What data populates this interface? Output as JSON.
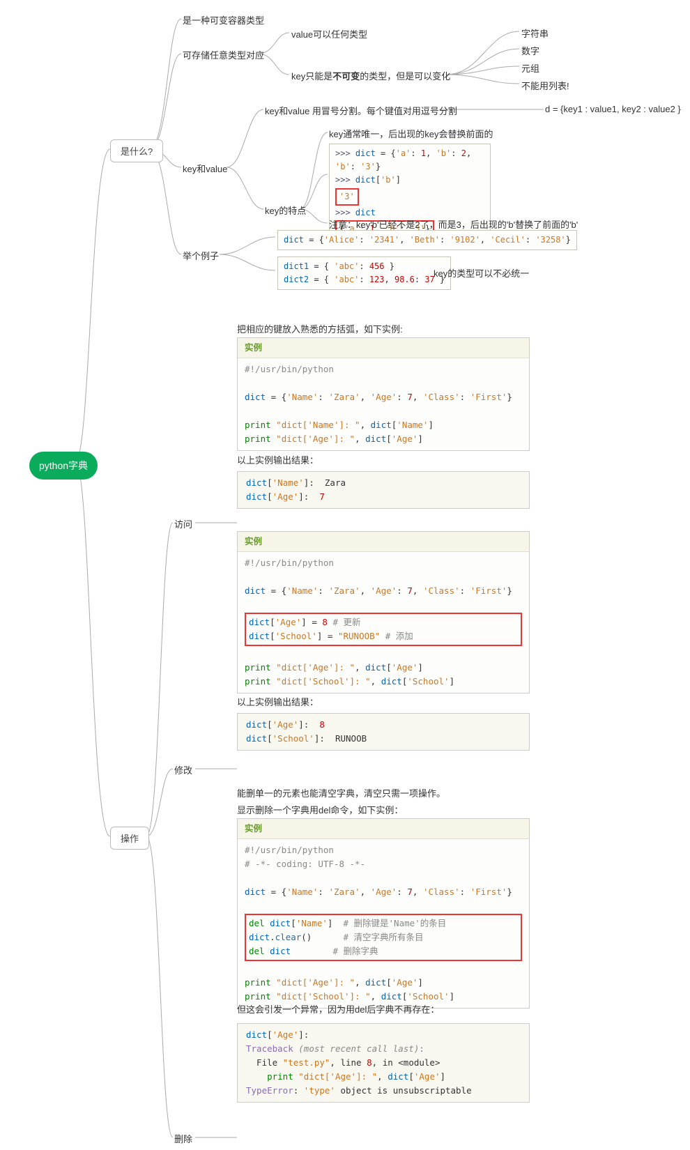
{
  "root": "python字典",
  "n_what": "是什么?",
  "n_ops": "操作",
  "what": {
    "container_type": "是一种可变容器类型",
    "store_any": "可存储任意类型对应",
    "value_any": "value可以任何类型",
    "key_immutable": "key只能是不可变的类型，但是可以变化",
    "kt_str": "字符串",
    "kt_num": "数字",
    "kt_tuple": "元组",
    "kt_nolist": "不能用列表!",
    "keyvalue": "key和value",
    "kv_sep": "key和value 用冒号分割。每个键值对用逗号分割",
    "kv_syntax": "d = {key1 : value1, key2 : value2 }",
    "key_feature": "key的特点",
    "key_unique": "key通常唯一，后出现的key会替换前面的",
    "key_note": "注意：key'b'已经不是2了，而是3，后出现的'b'替换了前面的'b'",
    "example": "举个例子",
    "ex_note": "key的类型可以不必统一"
  },
  "code": {
    "kv1": ">>> dict = {'a': 1, 'b': 2, 'b': '3'}",
    "kv2": ">>> dict['b']",
    "kv3": "'3'",
    "kv4": ">>> dict",
    "kv5": "{'a': 1, 'b': '3'}",
    "ex1": "dict = {'Alice': '2341', 'Beth': '9102', 'Cecil': '3258'}",
    "ex2a": "dict1 = { 'abc': 456 }",
    "ex2b": "dict2 = { 'abc': 123, 98.6: 37 }"
  },
  "ops": {
    "access": "访问",
    "modify": "修改",
    "delete": "删除",
    "inst_hdr": "实例",
    "access_intro": "把相应的键放入熟悉的方括弧，如下实例:",
    "access_out_lbl": "以上实例输出结果：",
    "modify_out_lbl": "以上实例输出结果：",
    "del_intro1": "能删单一的元素也能清空字典，清空只需一项操作。",
    "del_intro2": "显示删除一个字典用del命令，如下实例：",
    "del_exc": "但这会引发一个异常，因为用del后字典不再存在："
  },
  "access_code": {
    "shebang": "#!/usr/bin/python",
    "decl": "dict = {'Name': 'Zara', 'Age': 7, 'Class': 'First'}",
    "p1a": "print \"dict['Name']: \", dict['Name']",
    "p2a": "print \"dict['Age']: \", dict['Age']",
    "out1": "dict['Name']:  Zara",
    "out2": "dict['Age']:  7"
  },
  "modify_code": {
    "shebang": "#!/usr/bin/python",
    "decl": "dict = {'Name': 'Zara', 'Age': 7, 'Class': 'First'}",
    "u1": "dict['Age'] = 8 # 更新",
    "u2": "dict['School'] = \"RUNOOB\" # 添加",
    "p1": "print \"dict['Age']: \", dict['Age']",
    "p2": "print \"dict['School']: \", dict['School']",
    "out1": "dict['Age']:  8",
    "out2": "dict['School']:  RUNOOB"
  },
  "del_code": {
    "shebang": "#!/usr/bin/python",
    "coding": "# -*- coding: UTF-8 -*-",
    "decl": "dict = {'Name': 'Zara', 'Age': 7, 'Class': 'First'}",
    "d1": "del dict['Name']  # 删除键是'Name'的条目",
    "d2": "dict.clear()      # 清空字典所有条目",
    "d3": "del dict        # 删除字典",
    "p1": "print \"dict['Age']: \", dict['Age']",
    "p2": "print \"dict['School']: \", dict['School']",
    "tb1": "dict['Age']:",
    "tb2": "Traceback (most recent call last):",
    "tb3": "  File \"test.py\", line 8, in <module>",
    "tb4": "    print \"dict['Age']: \", dict['Age']",
    "tb5": "TypeError: 'type' object is unsubscriptable"
  }
}
